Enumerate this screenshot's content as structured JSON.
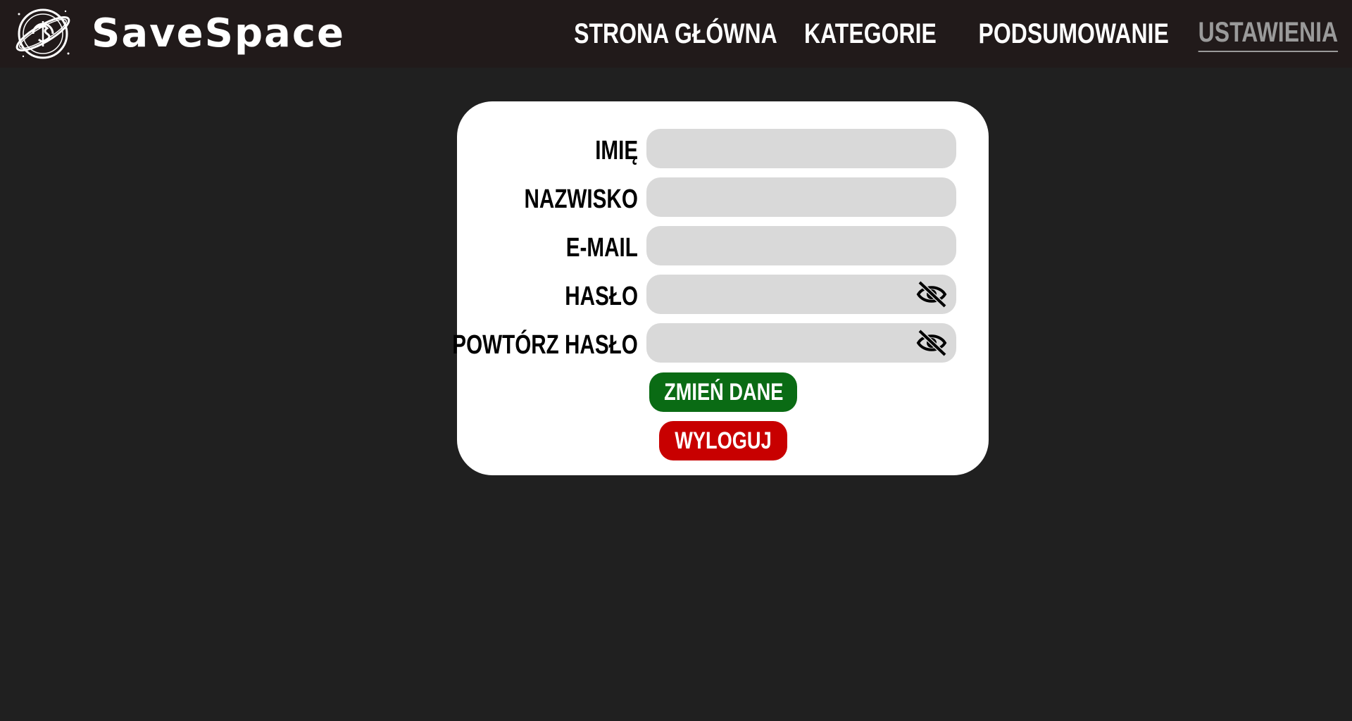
{
  "header": {
    "brand": "SaveSpace",
    "logo_icon": "planet-coin-logo",
    "nav": [
      {
        "label": "STRONA GŁÓWNA",
        "active": false
      },
      {
        "label": "KATEGORIE",
        "active": false
      },
      {
        "label": "PODSUMOWANIE",
        "active": false
      },
      {
        "label": "USTAWIENIA",
        "active": true
      }
    ]
  },
  "form": {
    "fields": [
      {
        "label": "IMIĘ",
        "value": "",
        "type": "text"
      },
      {
        "label": "NAZWISKO",
        "value": "",
        "type": "text"
      },
      {
        "label": "E-MAIL",
        "value": "",
        "type": "email"
      },
      {
        "label": "HASŁO",
        "value": "",
        "type": "password",
        "icon": "eye-slash-icon"
      },
      {
        "label": "POWTÓRZ HASŁO",
        "value": "",
        "type": "password",
        "icon": "eye-slash-icon"
      }
    ],
    "save_label": "ZMIEŃ DANE",
    "logout_label": "WYLOGUJ"
  },
  "colors": {
    "background": "#202020",
    "header": "#211a1a",
    "card": "#ffffff",
    "field": "#d9d9d9",
    "save_button": "#0a6b14",
    "logout_button": "#c80000",
    "nav_active": "#9a9a9a"
  }
}
